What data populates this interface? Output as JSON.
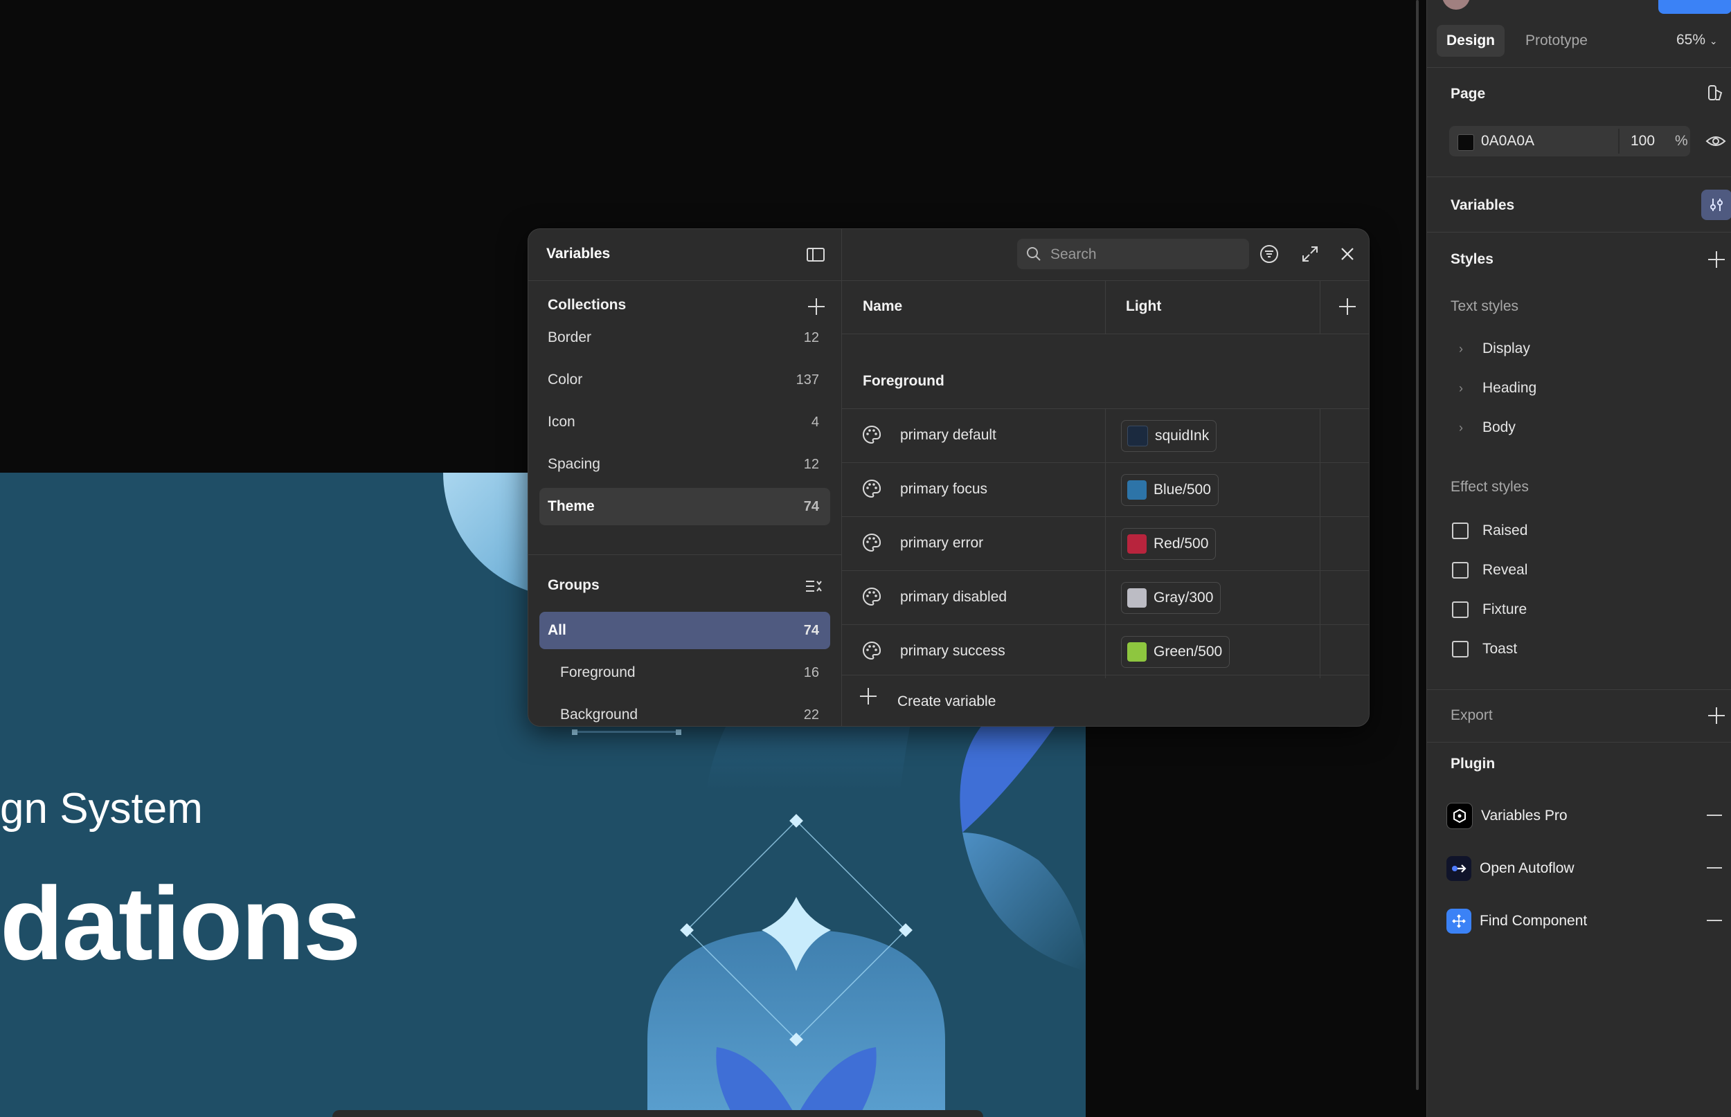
{
  "canvas": {
    "artwork_line1": "gn System",
    "artwork_line2": "dations"
  },
  "variables_modal": {
    "title": "Variables",
    "collections_title": "Collections",
    "collections": [
      {
        "name": "Border",
        "count": "12"
      },
      {
        "name": "Color",
        "count": "137"
      },
      {
        "name": "Icon",
        "count": "4"
      },
      {
        "name": "Spacing",
        "count": "12"
      },
      {
        "name": "Theme",
        "count": "74"
      }
    ],
    "groups_title": "Groups",
    "groups": [
      {
        "name": "All",
        "count": "74"
      },
      {
        "name": "Foreground",
        "count": "16"
      },
      {
        "name": "Background",
        "count": "22"
      }
    ],
    "search_placeholder": "Search",
    "column_name": "Name",
    "column_mode": "Light",
    "group_label": "Foreground",
    "variables": [
      {
        "name": "primary default",
        "value": "squidInk",
        "color": "#1b2a3f"
      },
      {
        "name": "primary focus",
        "value": "Blue/500",
        "color": "#2d74a8"
      },
      {
        "name": "primary error",
        "value": "Red/500",
        "color": "#b8243d"
      },
      {
        "name": "primary disabled",
        "value": "Gray/300",
        "color": "#bcbcc4"
      },
      {
        "name": "primary success",
        "value": "Green/500",
        "color": "#8ec63f"
      }
    ],
    "create_label": "Create variable"
  },
  "properties": {
    "tabs": {
      "design": "Design",
      "prototype": "Prototype"
    },
    "zoom": "65%",
    "page_title": "Page",
    "page_color_hex": "0A0A0A",
    "page_opacity": "100",
    "page_opacity_unit": "%",
    "variables_title": "Variables",
    "styles_title": "Styles",
    "text_styles_title": "Text styles",
    "text_styles": [
      "Display",
      "Heading",
      "Body"
    ],
    "effect_styles_title": "Effect styles",
    "effect_styles": [
      "Raised",
      "Reveal",
      "Fixture",
      "Toast"
    ],
    "export_title": "Export",
    "plugin_title": "Plugin",
    "plugins": [
      {
        "name": "Variables Pro",
        "icon": "variables-pro-icon"
      },
      {
        "name": "Open Autoflow",
        "icon": "autoflow-icon"
      },
      {
        "name": "Find Component",
        "icon": "find-component-icon"
      }
    ],
    "accent": "#3b82f6"
  }
}
